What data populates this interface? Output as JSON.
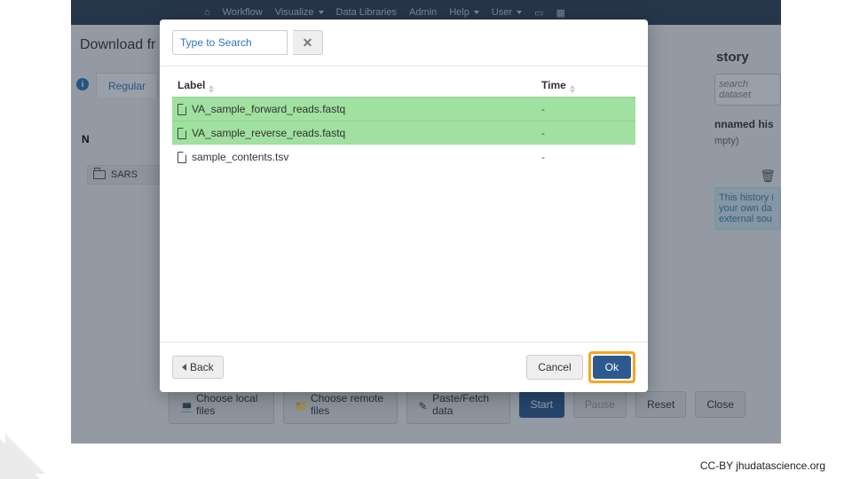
{
  "nav": {
    "items": [
      "Workflow",
      "Visualize",
      "Data Libraries",
      "Admin",
      "Help",
      "User"
    ]
  },
  "pane_title": "Download fr",
  "tab_regular": "Regular",
  "N": "N",
  "folder": "SARS",
  "buttons": {
    "local": "Choose local files",
    "remote": "Choose remote files",
    "paste": "Paste/Fetch data",
    "start": "Start",
    "pause": "Pause",
    "reset": "Reset",
    "close": "Close"
  },
  "right": {
    "history": "story",
    "search": "search dataset",
    "named": "nnamed his",
    "empty": "mpty)",
    "info": "This history i\nyour own da\nexternal sou"
  },
  "modal": {
    "search_placeholder": "Type to Search",
    "col_label": "Label",
    "col_time": "Time",
    "rows": [
      {
        "name": "VA_sample_forward_reads.fastq",
        "time": "-",
        "selected": true
      },
      {
        "name": "VA_sample_reverse_reads.fastq",
        "time": "-",
        "selected": true
      },
      {
        "name": "sample_contents.tsv",
        "time": "-",
        "selected": false
      }
    ],
    "back": "Back",
    "cancel": "Cancel",
    "ok": "Ok"
  },
  "attribution": "CC-BY  jhudatascience.org"
}
